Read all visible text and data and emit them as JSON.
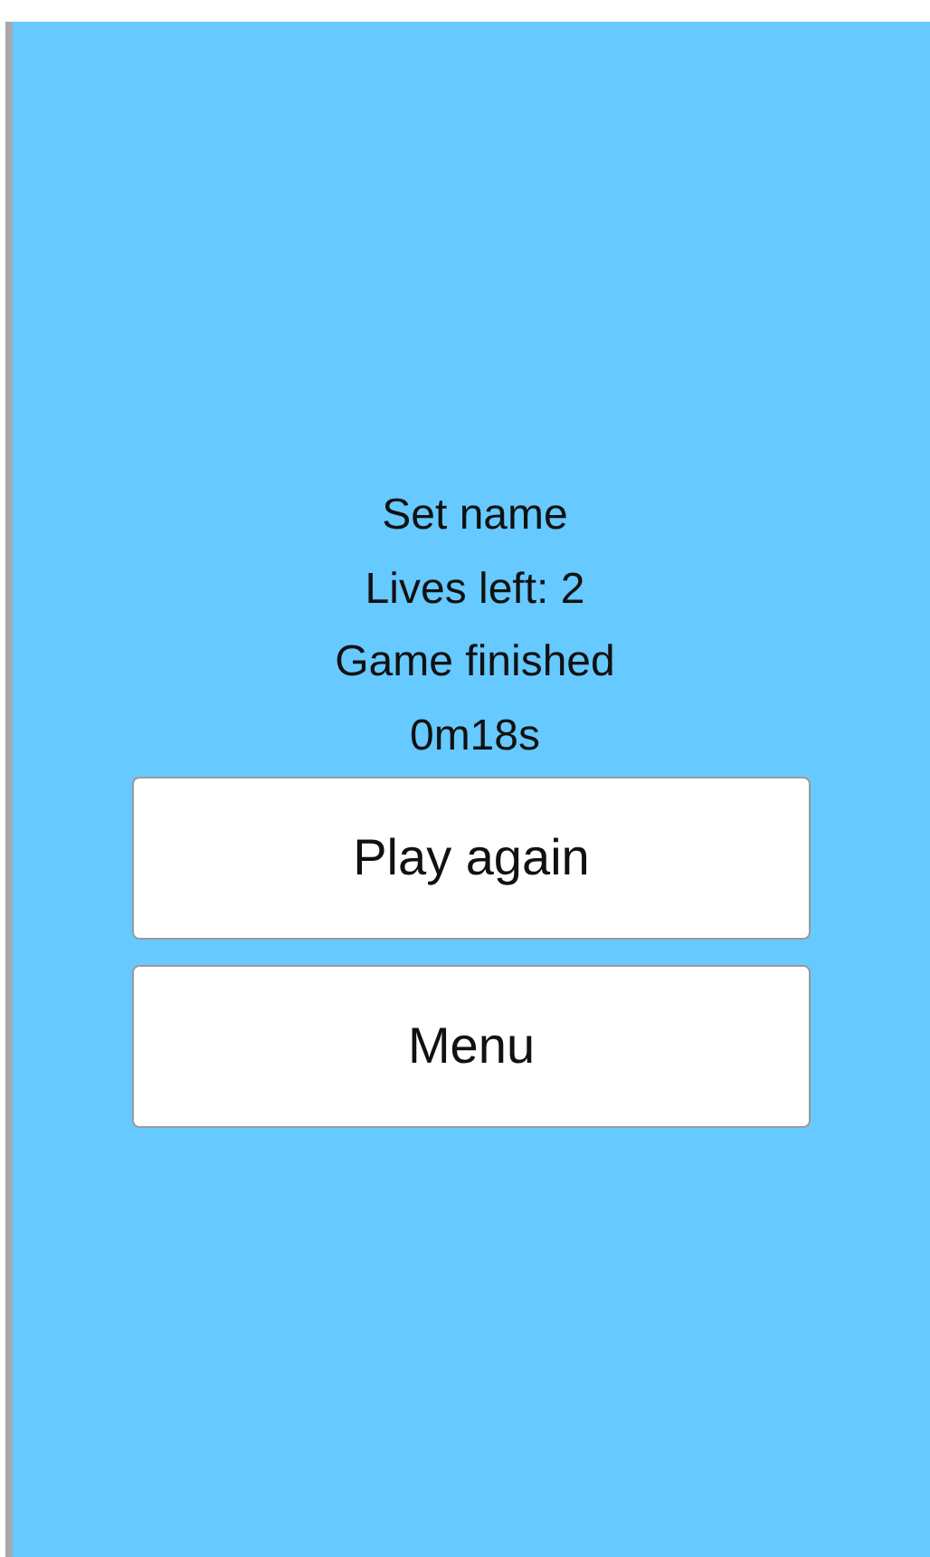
{
  "info_lines": [
    "Set name",
    "Lives left: 2",
    "Game finished",
    "0m18s"
  ],
  "buttons": [
    "Play again",
    "Menu"
  ]
}
